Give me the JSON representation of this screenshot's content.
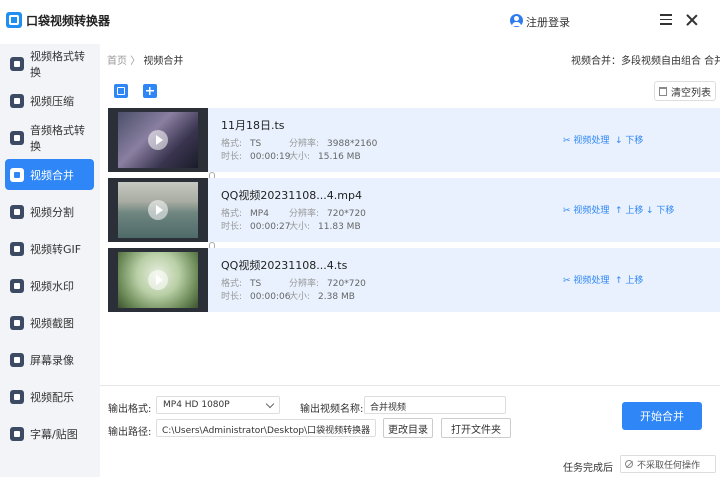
{
  "app": {
    "title": "口袋视频转换器",
    "login": "注册登录"
  },
  "sidebar": {
    "items": [
      {
        "label": "视频格式转换",
        "icon": "video-convert-icon"
      },
      {
        "label": "视频压缩",
        "icon": "compress-icon"
      },
      {
        "label": "音频格式转换",
        "icon": "audio-convert-icon"
      },
      {
        "label": "视频合并",
        "icon": "merge-icon",
        "active": true
      },
      {
        "label": "视频分割",
        "icon": "split-icon"
      },
      {
        "label": "视频转GIF",
        "icon": "gif-icon"
      },
      {
        "label": "视频水印",
        "icon": "watermark-icon"
      },
      {
        "label": "视频截图",
        "icon": "screenshot-icon"
      },
      {
        "label": "屏幕录像",
        "icon": "record-icon"
      },
      {
        "label": "视频配乐",
        "icon": "music-icon"
      },
      {
        "label": "字幕/贴图",
        "icon": "subtitle-icon"
      }
    ]
  },
  "breadcrumb": {
    "home": "首页",
    "sep": "〉",
    "current": "视频合并"
  },
  "hint": "视频合并：多段视频自由组合 合并成一段",
  "toolbar": {
    "clear": "清空列表"
  },
  "labels": {
    "format": "格式:",
    "resolution": "分辨率:",
    "duration": "时长:",
    "size": "大小:"
  },
  "files": [
    {
      "name": "11月18日.ts",
      "format": "TS",
      "resolution": "3988*2160",
      "duration": "00:00:19",
      "size": "15.16 MB",
      "actions": [
        "视频处理",
        "下移"
      ]
    },
    {
      "name": "QQ视频20231108...4.mp4",
      "format": "MP4",
      "resolution": "720*720",
      "duration": "00:00:27",
      "size": "11.83 MB",
      "actions": [
        "视频处理",
        "上移",
        "下移"
      ]
    },
    {
      "name": "QQ视频20231108...4.ts",
      "format": "TS",
      "resolution": "720*720",
      "duration": "00:00:06",
      "size": "2.38 MB",
      "actions": [
        "视频处理",
        "上移"
      ]
    }
  ],
  "bottom": {
    "format_label": "输出格式:",
    "format_value": "MP4  HD 1080P",
    "name_label": "输出视频名称:",
    "name_value": "合并视频",
    "path_label": "输出路径:",
    "path_value": "C:\\Users\\Administrator\\Desktop\\口袋视频转换器",
    "change_dir": "更改目录",
    "open_folder": "打开文件夹",
    "start": "开始合并",
    "done_label": "任务完成后",
    "done_value": "不采取任何操作"
  },
  "colors": {
    "accent": "#2f86f6",
    "row_bg": "#e8f1fd",
    "sidebar_bg": "#f2f4f8"
  }
}
